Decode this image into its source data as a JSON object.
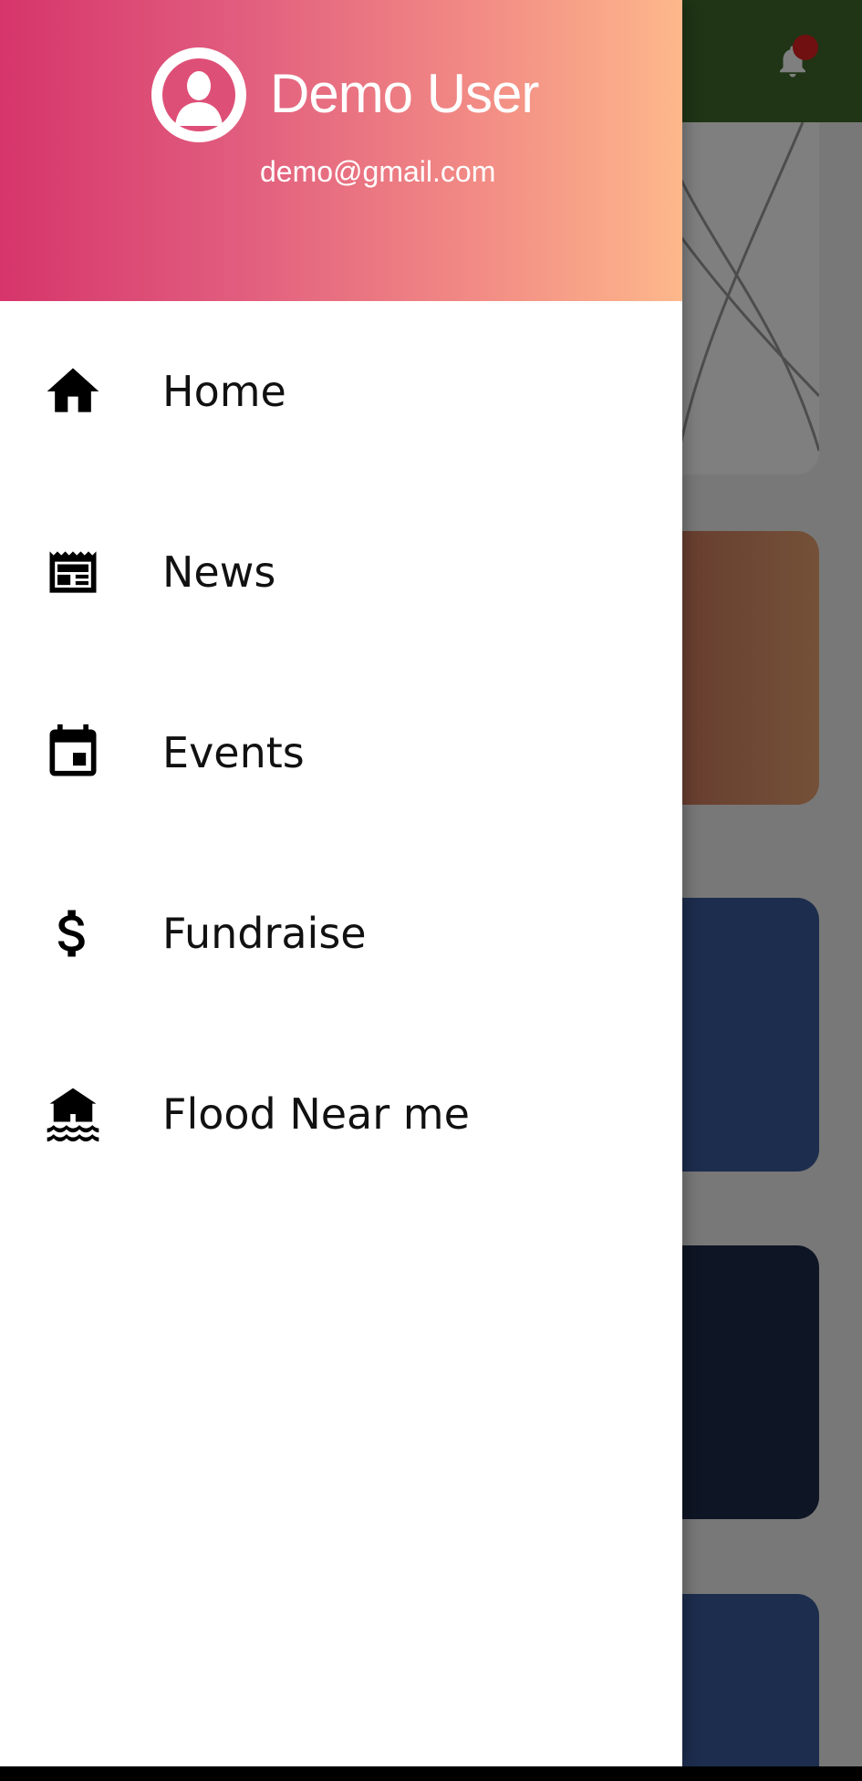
{
  "user": {
    "name": "Demo User",
    "email": "demo@gmail.com"
  },
  "menu": {
    "items": [
      {
        "label": "Home",
        "icon": "home-icon"
      },
      {
        "label": "News",
        "icon": "newspaper-icon"
      },
      {
        "label": "Events",
        "icon": "calendar-icon"
      },
      {
        "label": "Fundraise",
        "icon": "dollar-icon"
      },
      {
        "label": "Flood Near me",
        "icon": "flood-icon"
      }
    ]
  },
  "colors": {
    "header_gradient_start": "#d6356b",
    "header_gradient_end": "#fdb88b",
    "topbar": "#3f6b2a",
    "notification_dot": "#e02020"
  }
}
